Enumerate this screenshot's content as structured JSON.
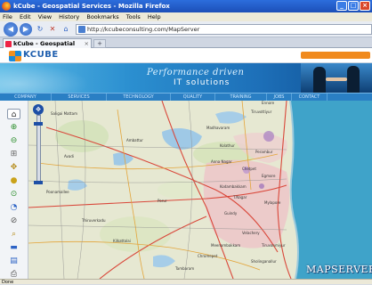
{
  "window": {
    "title": "kCube - Geospatial Services - Mozilla Firefox"
  },
  "menu": [
    "File",
    "Edit",
    "View",
    "History",
    "Bookmarks",
    "Tools",
    "Help"
  ],
  "nav": {
    "url": "http://kcubeconsulting.com/MapServer"
  },
  "tabs": [
    {
      "label": "kCube - Geospatial Services"
    }
  ],
  "site": {
    "logo_text": "KCUBE",
    "tagline_line1": "Performance driven",
    "tagline_line2": "IT solutions",
    "nav_items": [
      "COMPANY",
      "SERVICES",
      "TECHNOLOGY",
      "QUALITY",
      "TRAINING",
      "JOBS",
      "CONTACT"
    ]
  },
  "map": {
    "labels": [
      "Saligai Mattam",
      "Tiruvottiyur",
      "Ennore",
      "Madhavaram",
      "Ambattur",
      "Kolathur",
      "Perambur",
      "Anna Nagar",
      "Chetpet",
      "Egmore",
      "Kodambakkam",
      "T.Nagar",
      "Mylapore",
      "Porur",
      "Guindy",
      "Tambaram",
      "Velachery",
      "Kilkattalai",
      "Meenambakkam",
      "Chromepet",
      "Poonamallee",
      "Avadi",
      "Thiruverkadu",
      "Sholinganallur",
      "Tiruvanmiyur"
    ],
    "watermark": "MAPSERVER"
  },
  "status": {
    "text": "Done"
  },
  "colors": {
    "accent": "#2a7fc4",
    "brand_orange": "#f08a1e",
    "sea": "#3fa3c9"
  }
}
